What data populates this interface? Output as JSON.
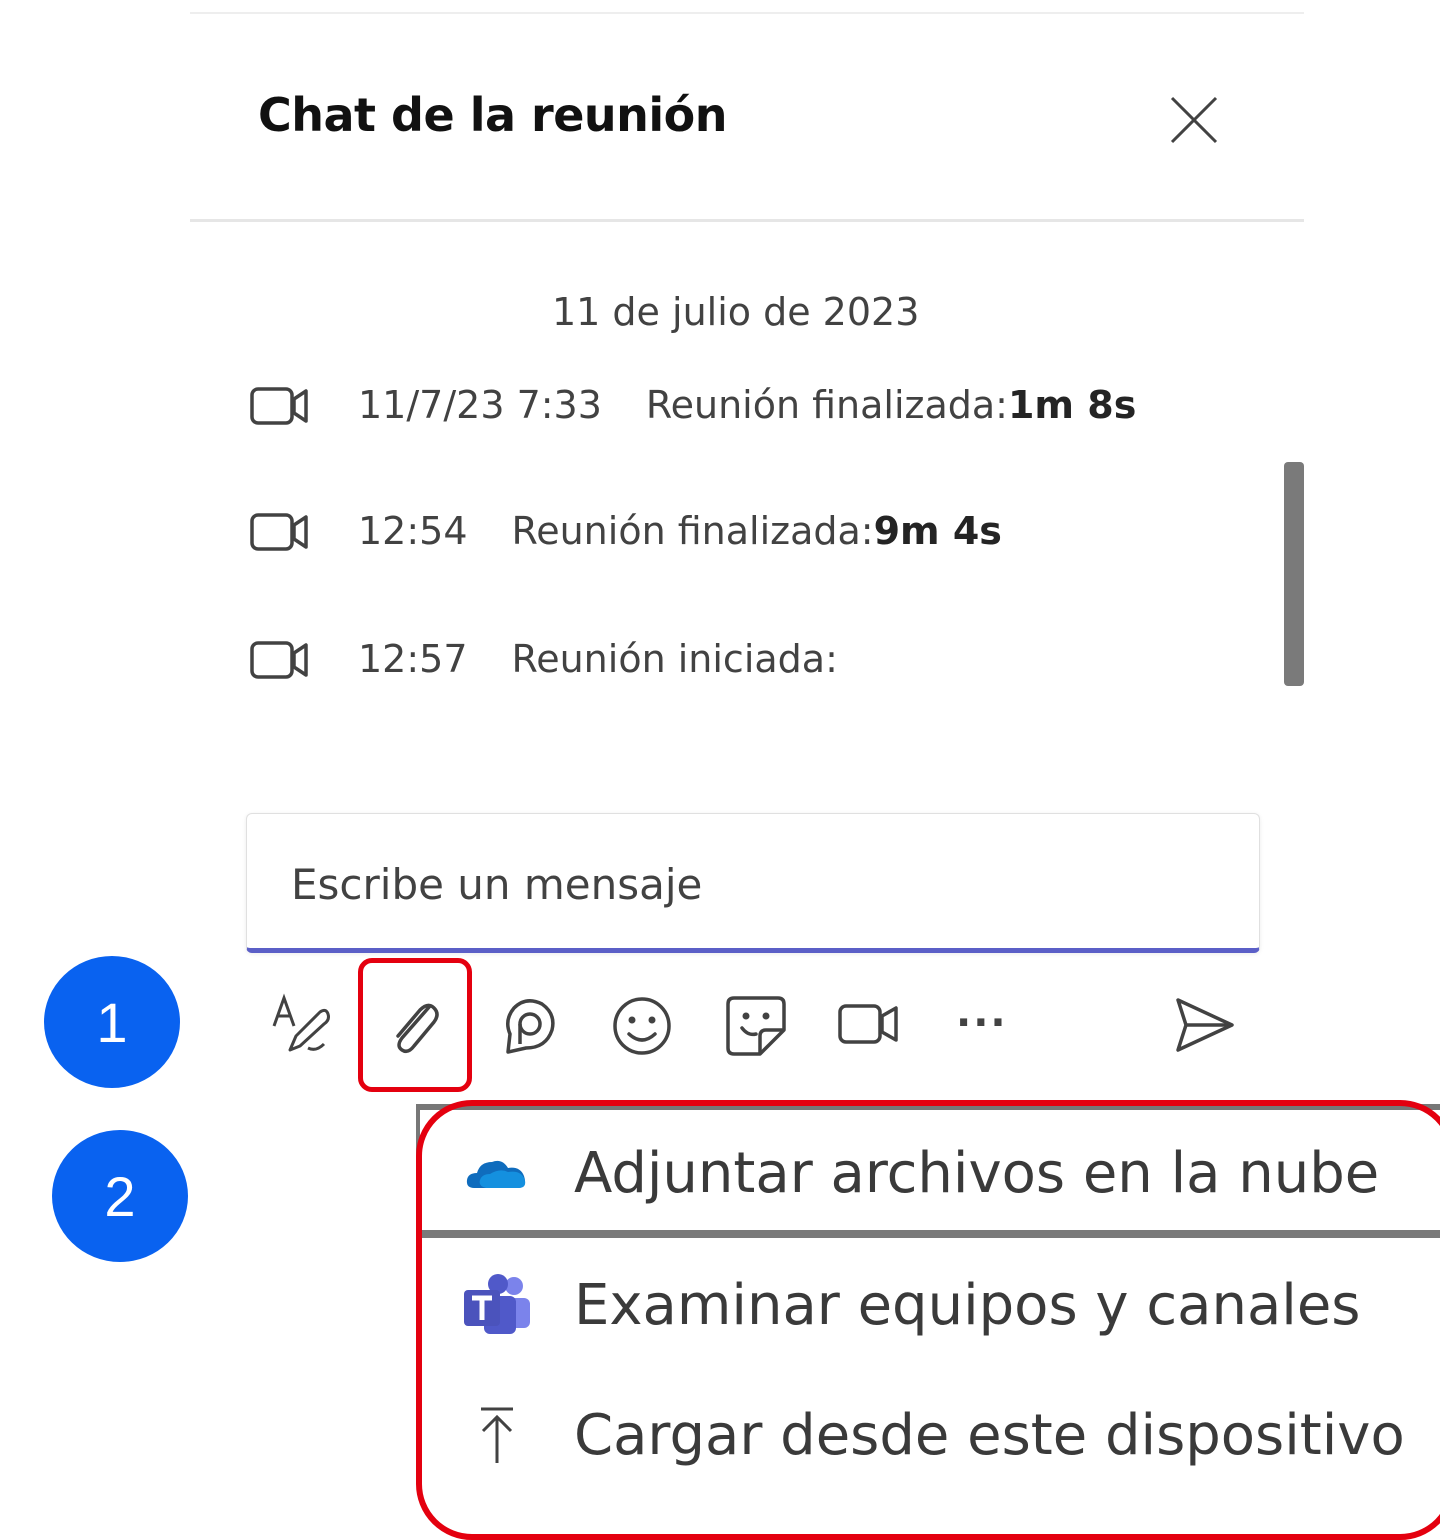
{
  "panel": {
    "title": "Chat de la reunión"
  },
  "chat": {
    "date": "11 de julio de 2023",
    "events": [
      {
        "time": "11/7/23 7:33",
        "text": "Reunión finalizada: ",
        "duration": "1m 8s"
      },
      {
        "time": "12:54",
        "text": "Reunión finalizada: ",
        "duration": "9m 4s"
      },
      {
        "time": "12:57",
        "text": "Reunión iniciada:",
        "duration": ""
      }
    ]
  },
  "compose": {
    "placeholder": "Escribe un mensaje"
  },
  "toolbar": {
    "icons": [
      "format-icon",
      "attach-icon",
      "loop-icon",
      "emoji-icon",
      "sticker-icon",
      "meet-now-icon",
      "more-icon",
      "send-icon"
    ],
    "more_label": "···"
  },
  "annotations": {
    "badge_1": "1",
    "badge_2": "2",
    "highlight_color": "#e4000f",
    "badge_color": "#0962f0"
  },
  "attach_menu": {
    "items": [
      {
        "label": "Adjuntar archivos en la nube",
        "icon": "onedrive-cloud-icon"
      },
      {
        "label": "Examinar equipos y canales",
        "icon": "teams-icon"
      },
      {
        "label": "Cargar desde este dispositivo",
        "icon": "upload-arrow-icon"
      }
    ]
  },
  "colors": {
    "accent": "#5b5fc7",
    "onedrive": "#0f6cbd",
    "teams": "#5059c9"
  }
}
